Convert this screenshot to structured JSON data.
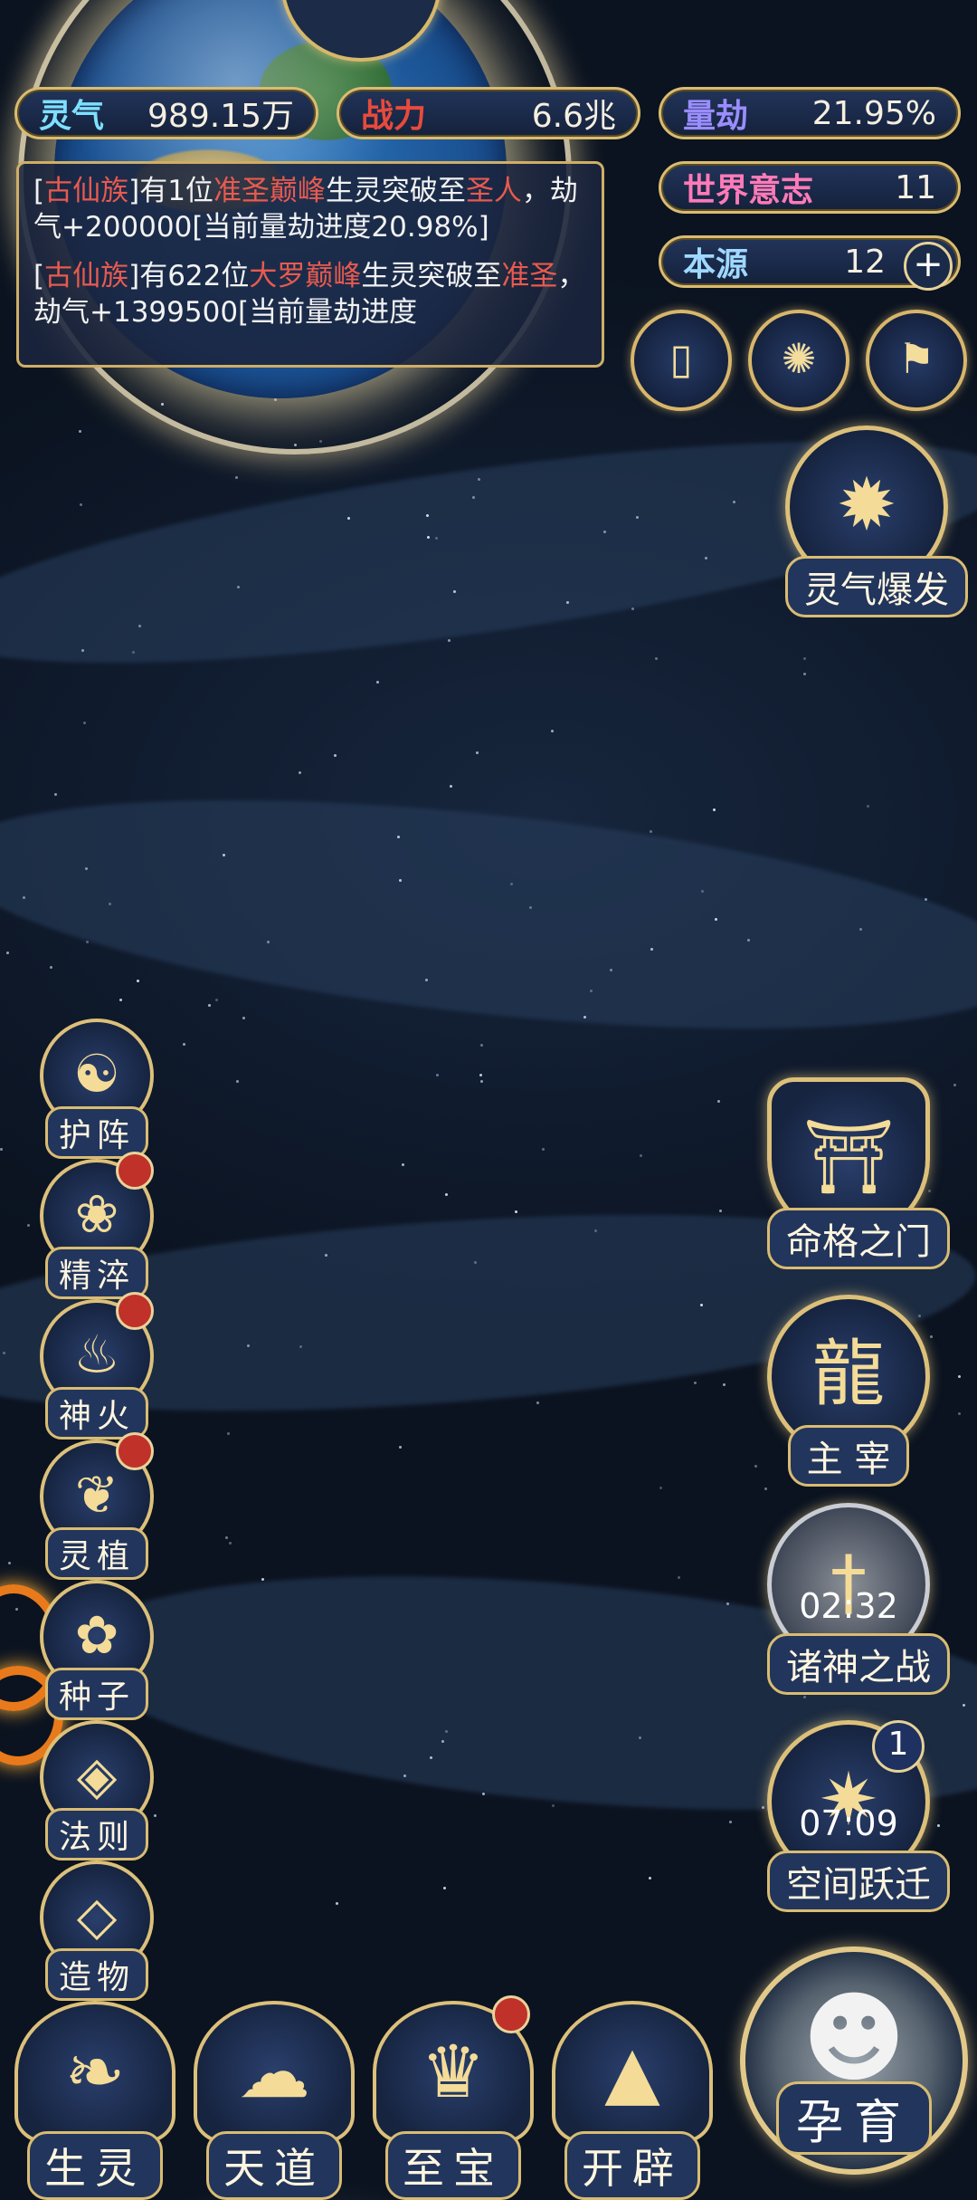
{
  "stats": {
    "lingqi": {
      "label": "灵气",
      "value": "989.15万",
      "color": "#7ee0ff"
    },
    "zhanli": {
      "label": "战力",
      "value": "6.6兆",
      "color": "#e84a3c"
    },
    "liangjie": {
      "label": "量劫",
      "value": "21.95%",
      "color": "#9a8dff"
    },
    "shijie": {
      "label": "世界意志",
      "value": "11",
      "color": "#ff7ab8"
    },
    "benyuan": {
      "label": "本源",
      "value": "12",
      "color": "#9fd8ff",
      "add_icon": "plus-icon"
    }
  },
  "log": [
    {
      "p1": "[",
      "tribe": "古仙族",
      "p2": "]有1位",
      "from": "准圣巅峰",
      "p3": "生灵突破至",
      "to": "圣人",
      "p4": "，劫气+200000[当前量劫进度20.98%]"
    },
    {
      "p1": "[",
      "tribe": "古仙族",
      "p2": "]有622位",
      "from": "大罗巅峰",
      "p3": "生灵突破至",
      "to": "准圣",
      "p4": "，劫气+1399500[当前量劫进度"
    }
  ],
  "quick_buttons": [
    "card-icon",
    "vortex-icon",
    "flag-icon"
  ],
  "right_column": {
    "burst": {
      "label": "灵气爆发",
      "icon": "burst-icon"
    },
    "fate_gate": {
      "label": "命格之门",
      "icon": "gate-icon"
    },
    "ruler": {
      "label": "主 宰",
      "icon": "dragon-icon"
    },
    "war": {
      "label": "诸神之战",
      "timer": "02:32",
      "icon": "sword-icon"
    },
    "space": {
      "label": "空间跃迁",
      "timer": "07:09",
      "badge": "1",
      "icon": "portal-icon"
    }
  },
  "left_column": [
    {
      "label": "护阵",
      "icon": "yinyang-icon",
      "dot": false
    },
    {
      "label": "精淬",
      "icon": "lotus-icon",
      "dot": true
    },
    {
      "label": "神火",
      "icon": "flame-icon",
      "dot": true
    },
    {
      "label": "灵植",
      "icon": "plant-icon",
      "dot": true
    },
    {
      "label": "种子",
      "icon": "seed-icon",
      "dot": false
    },
    {
      "label": "法则",
      "icon": "rule-icon",
      "dot": false
    },
    {
      "label": "造物",
      "icon": "creation-icon",
      "dot": false
    }
  ],
  "bottom_nav": [
    {
      "label": "生灵",
      "icon": "phoenix-icon",
      "dot": false
    },
    {
      "label": "天道",
      "icon": "cloud-icon",
      "dot": false
    },
    {
      "label": "至宝",
      "icon": "treasure-icon",
      "dot": true
    },
    {
      "label": "开辟",
      "icon": "mountain-icon",
      "dot": false
    }
  ],
  "nurture": {
    "label": "孕育",
    "icon": "embryo-icon"
  }
}
